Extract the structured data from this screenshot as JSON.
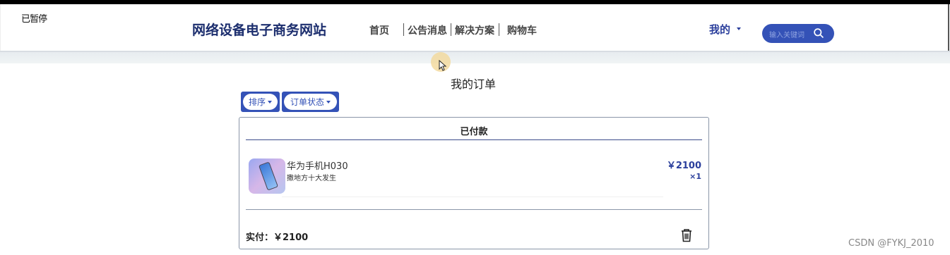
{
  "overlay": {
    "paused_label": "已暂停"
  },
  "header": {
    "brand": "网络设备电子商务网站",
    "nav": [
      "首页",
      "公告消息",
      "解决方案",
      "购物车"
    ],
    "user_menu": "我的",
    "search_placeholder": "输入关键词"
  },
  "page": {
    "title": "我的订单"
  },
  "filters": {
    "sort_label": "排序",
    "status_label": "订单状态"
  },
  "order": {
    "status": "已付款",
    "item": {
      "name": "华为手机H030",
      "description": "撒地方十大发生",
      "price": "￥2100",
      "quantity": "×1"
    },
    "total": "实付：￥2100"
  },
  "watermark": "CSDN @FYKJ_2010",
  "colors": {
    "accent": "#3452b7",
    "brand": "#1c2e6e"
  }
}
